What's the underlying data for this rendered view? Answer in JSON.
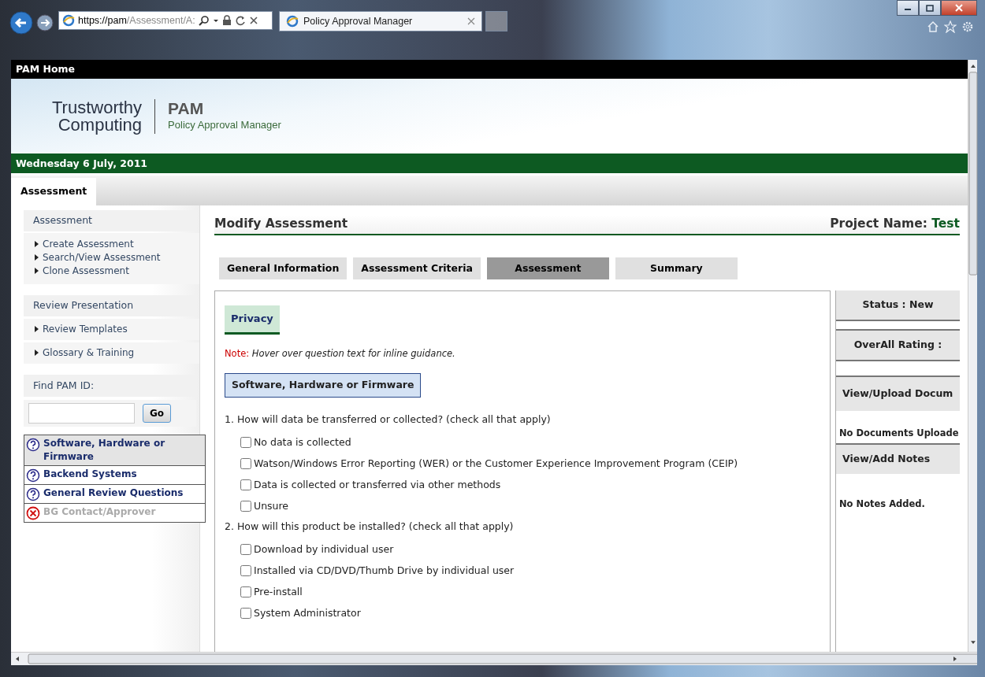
{
  "browser": {
    "address_host": "https://pam",
    "address_path": "/Assessment/A:",
    "tab_title": "Policy Approval Manager"
  },
  "header": {
    "top_bar": "PAM Home",
    "logo_line_1": "Trustworthy",
    "logo_line_2": "Computing",
    "app_name": "PAM",
    "app_subtitle": "Policy Approval Manager",
    "date": "Wednesday 6 July, 2011"
  },
  "main_tabs": [
    {
      "label": "Assessment",
      "selected": true
    }
  ],
  "sidebar": {
    "assessment_heading": "Assessment",
    "assessment_links": [
      "Create Assessment",
      "Search/View Assessment",
      "Clone Assessment"
    ],
    "review_heading": "Review Presentation",
    "review_links": [
      "Review Templates",
      "Glossary & Training"
    ],
    "find_label": "Find PAM ID:",
    "go_button": "Go",
    "sections": [
      {
        "label": "Software, Hardware or Firmware",
        "kind": "help",
        "selected": true,
        "disabled": false
      },
      {
        "label": "Backend Systems",
        "kind": "help",
        "selected": false,
        "disabled": false
      },
      {
        "label": "General Review Questions",
        "kind": "help",
        "selected": false,
        "disabled": false
      },
      {
        "label": "BG Contact/Approver",
        "kind": "blocked",
        "selected": false,
        "disabled": true
      }
    ]
  },
  "content": {
    "title": "Modify Assessment",
    "project_label": "Project Name:",
    "project_value": "Test",
    "tabs": [
      {
        "label": "General Information",
        "selected": false
      },
      {
        "label": "Assessment Criteria",
        "selected": false
      },
      {
        "label": "Assessment",
        "selected": true
      },
      {
        "label": "Summary",
        "selected": false
      }
    ],
    "section_tab": "Privacy",
    "note_label": "Note:",
    "note_text": "Hover over question text for inline guidance.",
    "section_heading": "Software, Hardware or Firmware",
    "questions": [
      {
        "text": "1. How will data be transferred or collected? (check all that apply)",
        "options": [
          {
            "label": "No data is collected",
            "checked": false
          },
          {
            "label": "Watson/Windows Error Reporting (WER) or the Customer Experience Improvement Program (CEIP)",
            "checked": false
          },
          {
            "label": "Data is collected or transferred via other methods",
            "checked": false
          },
          {
            "label": "Unsure",
            "checked": false
          }
        ]
      },
      {
        "text": "2. How will this product be installed? (check all that apply)",
        "options": [
          {
            "label": "Download by individual user",
            "checked": false
          },
          {
            "label": "Installed via CD/DVD/Thumb Drive by individual user",
            "checked": false
          },
          {
            "label": "Pre-install",
            "checked": false
          },
          {
            "label": "System Administrator",
            "checked": false
          }
        ]
      }
    ]
  },
  "side_panel": {
    "status": "Status : New",
    "rating": "OverAll Rating :",
    "docs_heading": "View/Upload Docum",
    "docs_text": "No Documents Uploade",
    "notes_heading": "View/Add Notes",
    "notes_text": "No Notes Added."
  }
}
